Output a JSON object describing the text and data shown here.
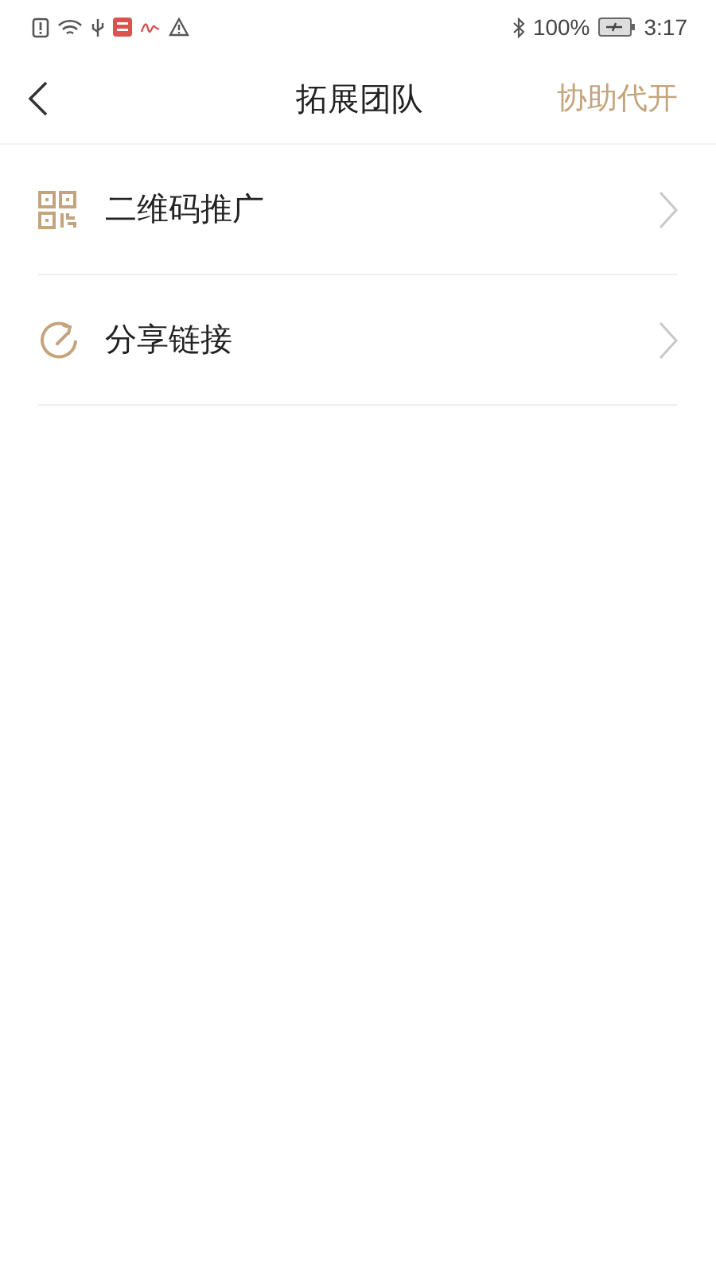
{
  "status_bar": {
    "battery": "100%",
    "time": "3:17"
  },
  "nav": {
    "title": "拓展团队",
    "action": "协助代开"
  },
  "items": [
    {
      "kind": "qr",
      "label": "二维码推广"
    },
    {
      "kind": "share",
      "label": "分享链接"
    }
  ]
}
